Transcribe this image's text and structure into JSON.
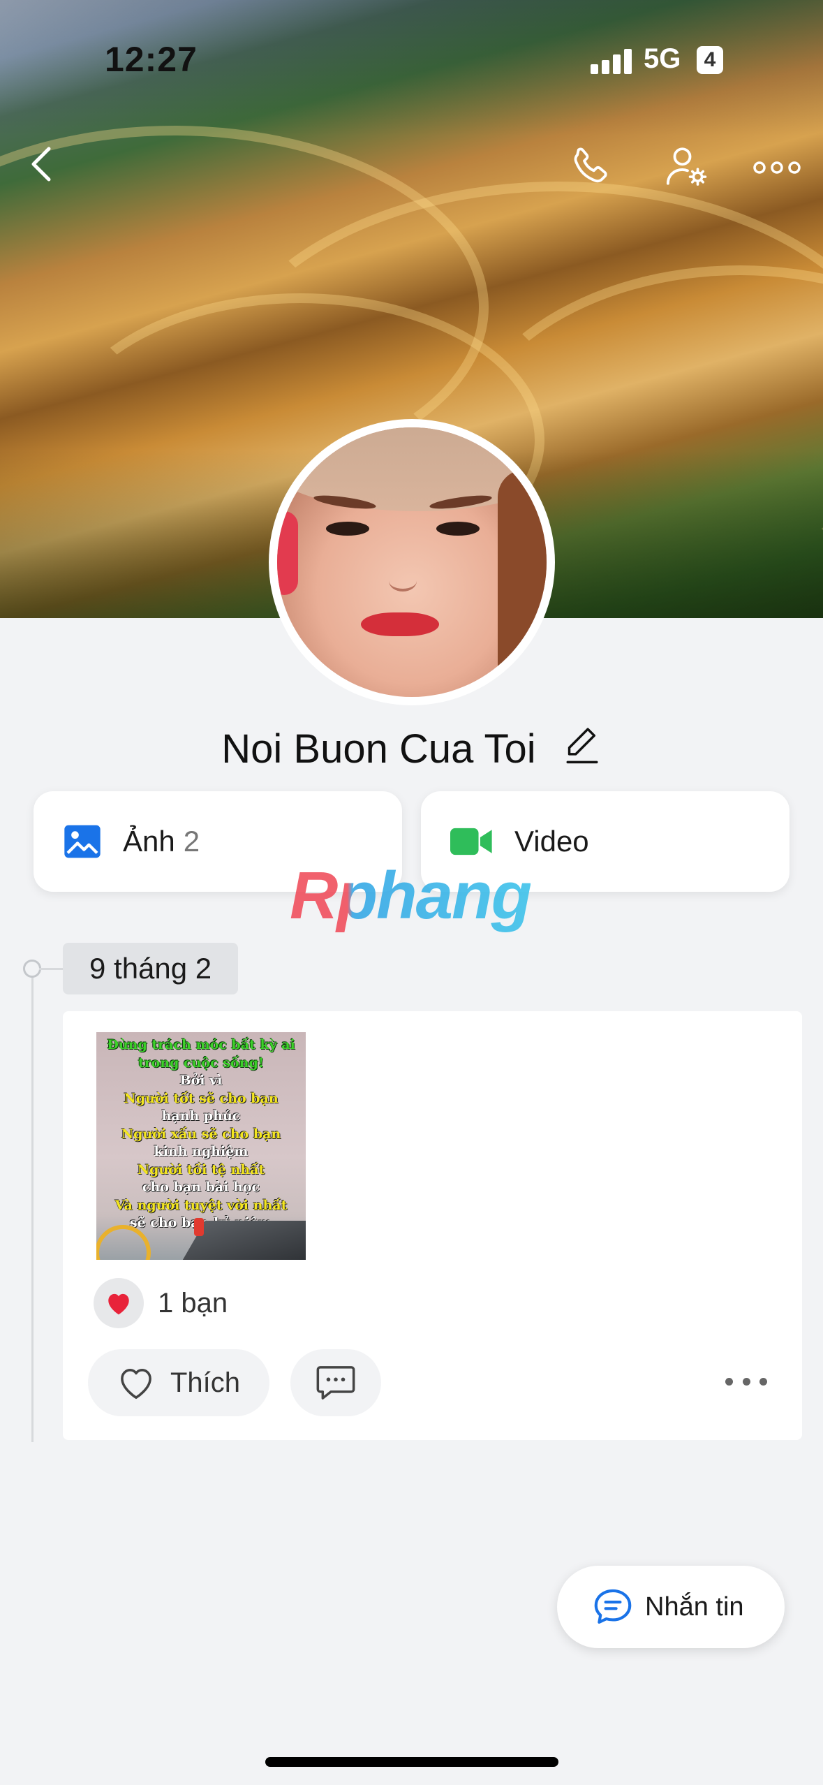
{
  "status_bar": {
    "time": "12:27",
    "network": "5G",
    "battery": "4"
  },
  "profile": {
    "name": "Noi Buon Cua Toi"
  },
  "media": {
    "photos": {
      "label": "Ảnh",
      "count": "2"
    },
    "video": {
      "label": "Video"
    }
  },
  "watermark": "Rphang",
  "timeline": {
    "date": "9 tháng 2",
    "post": {
      "image_lines": [
        "Đừng trách móc bất kỳ ai",
        "trong cuộc sống!",
        "Bởi vì",
        "Người tốt sẽ cho bạn",
        "hạnh phúc",
        "Người xấu sẽ cho bạn",
        "kinh nghiệm",
        "Người tồi tệ nhất",
        "cho bạn bài học",
        "Và người tuyệt vời nhất",
        "sẽ cho bạn kỷ niệm"
      ],
      "reaction_count": "1 bạn",
      "like_label": "Thích"
    }
  },
  "message_button": {
    "label": "Nhắn tin"
  },
  "colors": {
    "accent_blue": "#1a73e8",
    "video_green": "#2fbd5a",
    "heart_red": "#e8233a",
    "background": "#f2f3f5"
  },
  "icons": {
    "back": "chevron-left-icon",
    "call": "phone-icon",
    "settings": "user-settings-icon",
    "more": "more-horizontal-icon",
    "edit": "pencil-icon",
    "photo": "image-icon",
    "video": "video-camera-icon",
    "heart": "heart-icon",
    "comment": "comment-icon",
    "message": "chat-bubble-icon"
  }
}
